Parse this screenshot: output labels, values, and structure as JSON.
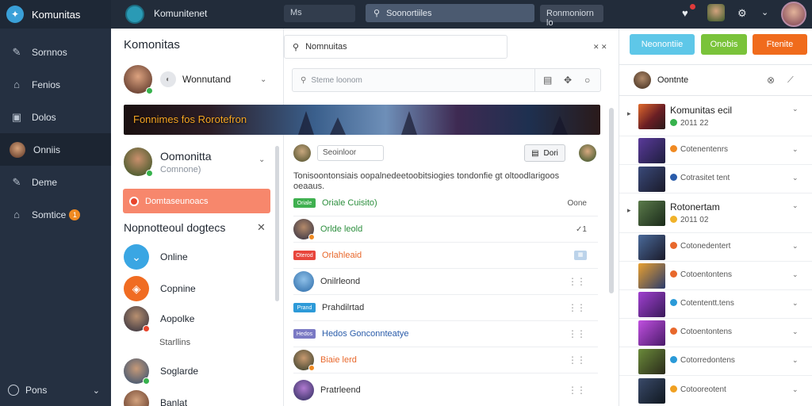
{
  "sidebar": {
    "brand": "Komunitas",
    "items": [
      {
        "label": "Sornnos",
        "icon": "pin-icon"
      },
      {
        "label": "Fenios",
        "icon": "home-icon"
      },
      {
        "label": "Dolos",
        "icon": "inbox-icon"
      },
      {
        "label": "Onniis",
        "icon": "avatar",
        "active": true
      },
      {
        "label": "Deme",
        "icon": "pin-icon"
      },
      {
        "label": "Somtice",
        "icon": "home-icon",
        "badge": "1"
      }
    ],
    "footer": "Pons"
  },
  "topbar": {
    "title": "Komunitenet",
    "workspace": "Ms",
    "search_placeholder": "Soonortiiles",
    "filter": "Ronmoniorn lo"
  },
  "panel": {
    "title": "Komonitas",
    "user1": "Wonnutand",
    "banner_text": "Fonnimes fos Rorotefron",
    "user2_name": "Oomonitta",
    "user2_sub": "Comnone)",
    "highlight": "Domtaseunoacs",
    "section_title": "Nopnotteoul dogtecs",
    "entries": [
      {
        "label": "Online",
        "color": "#3aa6e3",
        "icon": "chevron-icon"
      },
      {
        "label": "Copnine",
        "color": "#f06c22",
        "icon": "leaf-icon"
      },
      {
        "label": "Aopolke",
        "color": "",
        "icon": "avatar"
      },
      {
        "label": "Soglarde",
        "color": "",
        "icon": "avatar"
      },
      {
        "label": "Banlat",
        "color": "",
        "icon": "avatar"
      }
    ],
    "entry_sub": "Starllins"
  },
  "feed": {
    "top_search": "Nomnuitas",
    "top_x": "✕ ✕",
    "search2_placeholder": "Steme loonom",
    "post_pill": "Seoinloor",
    "post_btn": "Dori",
    "post_text": "Tonisoontonsiais oopalnedeetoobitsiogies tondonfie gt oltoodlarigoos oeaaus.",
    "rows": [
      {
        "tag": "Oriale",
        "tag_color": "#3fb04f",
        "text": "Oriale Cuisito)",
        "text_color": "#2d8f3e",
        "right": "Oone",
        "type": "tag"
      },
      {
        "text": "Orlde leold",
        "text_color": "#2d8f3e",
        "right": "✓1",
        "type": "avatar"
      },
      {
        "tag": "Oterod",
        "tag_color": "#e8453c",
        "text": "Orlahleaid",
        "text_color": "#e8682c",
        "right": "",
        "type": "tag-sq"
      },
      {
        "tag": "Onilre",
        "tag_color": "#2d9ad8",
        "text": "Onilrleond",
        "text_color": "#333",
        "right": "",
        "type": "tag-dots"
      },
      {
        "tag": "Prand",
        "tag_color": "#2d9ad8",
        "text": "Prahdilrtad",
        "text_color": "#333",
        "right": "",
        "type": "tag-dots"
      },
      {
        "tag": "Hedos",
        "tag_color": "#7a79c4",
        "text": "Hedos Gonconnteatye",
        "text_color": "#2a5caa",
        "right": "",
        "type": "tag-dots"
      },
      {
        "text": "Biaie lerd",
        "text_color": "#e8682c",
        "right": "",
        "type": "avatar-dots"
      },
      {
        "text": "Pratrleend",
        "text_color": "#333",
        "right": "",
        "type": "avatar-dots"
      }
    ]
  },
  "right": {
    "buttons": [
      {
        "label": "Neonontiie",
        "color": "#5ec7e8"
      },
      {
        "label": "Onobis",
        "color": "#7ac33a"
      },
      {
        "label": "Ftenite",
        "color": "#f06b1c"
      }
    ],
    "head": "Oontnte",
    "rows": [
      {
        "title": "Komunitas ecil",
        "sub": "2011 22",
        "dot": "#37b24d",
        "big": true,
        "arrow": true
      },
      {
        "title": "Cotenentenrs",
        "sub": "",
        "dot": "#f08a22",
        "big": false
      },
      {
        "title": "Cotrasitet tent",
        "sub": "",
        "dot": "#2a5caa",
        "big": false
      },
      {
        "title": "Rotonertam",
        "sub": "2011 02",
        "dot": "#f0b22a",
        "big": true,
        "arrow": true
      },
      {
        "title": "Cotonedentert",
        "sub": "",
        "dot": "#e8682c",
        "big": false
      },
      {
        "title": "Cotoentontens",
        "sub": "",
        "dot": "#e8682c",
        "big": false
      },
      {
        "title": "Cotententt.tens",
        "sub": "",
        "dot": "#2a9ad8",
        "big": false
      },
      {
        "title": "Cotoentontens",
        "sub": "",
        "dot": "#e8682c",
        "big": false
      },
      {
        "title": "Cotorredontens",
        "sub": "",
        "dot": "#2a9ad8",
        "big": false
      },
      {
        "title": "Cotooreotent",
        "sub": "",
        "dot": "#f0a022",
        "big": false
      }
    ]
  }
}
